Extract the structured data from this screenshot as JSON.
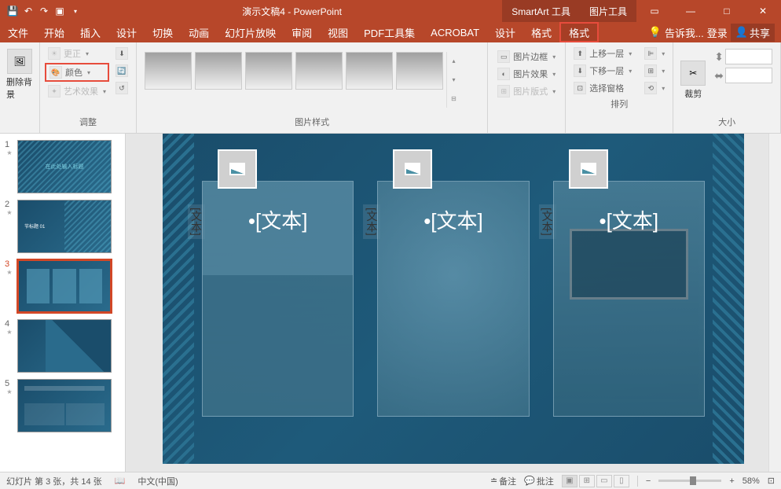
{
  "titlebar": {
    "title": "演示文稿4 - PowerPoint",
    "tool_tabs": [
      "SmartArt 工具",
      "图片工具"
    ]
  },
  "menu": {
    "items": [
      "文件",
      "开始",
      "插入",
      "设计",
      "切换",
      "动画",
      "幻灯片放映",
      "审阅",
      "视图",
      "PDF工具集",
      "ACROBAT",
      "设计",
      "格式",
      "格式"
    ],
    "tell_me": "告诉我...",
    "login": "登录",
    "share": "共享"
  },
  "ribbon": {
    "remove_bg": "删除背景",
    "adjust": {
      "corrections": "更正",
      "color": "颜色",
      "artistic": "艺术效果",
      "label": "调整"
    },
    "styles": {
      "label": "图片样式"
    },
    "pic_options": {
      "border": "图片边框",
      "effects": "图片效果",
      "layout": "图片版式"
    },
    "arrange": {
      "bring_forward": "上移一层",
      "send_backward": "下移一层",
      "selection_pane": "选择窗格",
      "label": "排列"
    },
    "size": {
      "crop": "裁剪",
      "label": "大小"
    }
  },
  "slides": {
    "thumb1_title": "在此处输入标题",
    "thumb2_title": "节标题 01",
    "panel_text": "•[文本]",
    "panel_tab": "[文本]"
  },
  "status": {
    "slide_info": "幻灯片 第 3 张，共 14 张",
    "language": "中文(中国)",
    "notes": "备注",
    "comments": "批注",
    "zoom": "58%"
  }
}
